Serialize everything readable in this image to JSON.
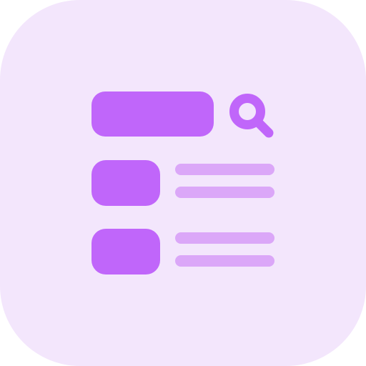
{
  "icon": {
    "name": "search-results-list-icon",
    "colors": {
      "background": "#f3e6fc",
      "primary": "#c066fa",
      "secondary": "#dba7f8"
    },
    "search_bar": {
      "icon": "search-icon"
    },
    "results": [
      {
        "thumbnail": "result-thumbnail",
        "lines": 2
      },
      {
        "thumbnail": "result-thumbnail",
        "lines": 2
      }
    ]
  }
}
